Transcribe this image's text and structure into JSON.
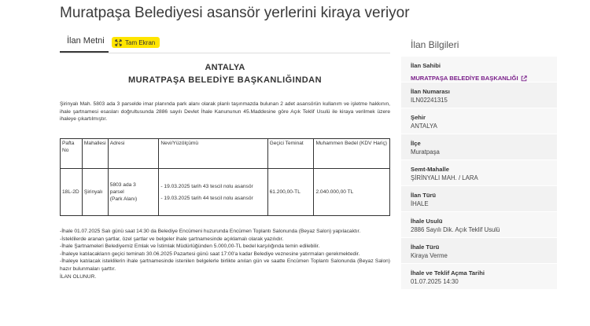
{
  "page": {
    "title": "Muratpaşa Belediyesi asansör yerlerini kiraya veriyor"
  },
  "tabs": {
    "ilan_metni": "İlan Metni",
    "fullscreen": "Tam Ekran"
  },
  "document": {
    "heading1": "ANTALYA",
    "heading2": "MURATPAŞA BELEDİYE BAŞKANLIĞINDAN",
    "intro": "Şirinyalı Mah. 5803 ada 3 parselde imar planında park alanı olarak planlı taşınmazda bulunan 2 adet asansörün kullanım ve işletme hakkının, ihale şartnamesi esasları doğrultusunda 2886 sayılı Devlet İhale Kanununun 45.Maddesine göre Açık Teklif Usulü ile kiraya verilmek üzere ihaleye çıkartılmıştır.",
    "table": {
      "headers": [
        "Pafta No",
        "Mahallesi",
        "Adresi",
        "Nevi/Yüzölçümü",
        "Geçici Teminat",
        "Muhammen Bedel (KDV Hariç)"
      ],
      "row": {
        "pafta": "18L-2D",
        "mahalle": "Şirinyalı",
        "adres_1": "5803 ada 3",
        "adres_2": "parsel",
        "adres_3": "(Park Alanı)",
        "nevi_1": "- 19.03.2025 tarih 43 tescil nolu asansör",
        "nevi_2": "- 19.03.2025 tarih 44 tescil nolu asansör",
        "teminat": "61.200,00-TL",
        "bedel": "2.040.000,00 TL"
      }
    },
    "notes": [
      "-İhale 01.07.2025 Salı günü saat 14:30 da Belediye Encümeni huzurunda Encümen Toplantı Salonunda (Beyaz Salon) yapılacaktır.",
      "-İsteklilerde aranan şartlar, özel şartlar ve belgeler ihale şartnamesinde açıklamalı olarak yazılıdır.",
      "-İhale Şartnameleri Belediyemiz Emlak ve İstimlak Müdürlüğünden 5.000,00-TL bedel karşılığında temin edilebilir.",
      "-İhaleye katılacakların geçici teminatı 30.06.2025 Pazartesi günü saat 17:00'a kadar Belediye veznesine yatırmaları gerekmektedir.",
      "-İhaleye katılacak isteklilerin ihale şartnamesinde istenilen belgelerle birlikte anılan gün ve saatte Encümen Toplantı Salonunda (Beyaz Salon) hazır bulunmaları şarttır.",
      "İLAN OLUNUR."
    ]
  },
  "side": {
    "title": "İlan Bilgileri",
    "items": [
      {
        "label": "İlan Sahibi",
        "value": "MURATPAŞA BELEDİYE BAŞKANLIĞI"
      },
      {
        "label": "İlan Numarası",
        "value": "ILN02241315"
      },
      {
        "label": "Şehir",
        "value": "ANTALYA"
      },
      {
        "label": "İlçe",
        "value": "Muratpaşa"
      },
      {
        "label": "Semt-Mahalle",
        "value": "ŞİRİNYALI MAH. / LARA"
      },
      {
        "label": "İlan Türü",
        "value": "İHALE"
      },
      {
        "label": "İhale Usulü",
        "value": "2886 Sayılı Dik. Açık Teklif Usulü"
      },
      {
        "label": "İhale Türü",
        "value": "Kiraya Verme"
      },
      {
        "label": "İhale ve Teklif Açma Tarihi",
        "value": "01.07.2025 14:30"
      }
    ]
  },
  "colors": {
    "accent_yellow": "#ffe500",
    "link_purple": "#7a1f8a"
  }
}
